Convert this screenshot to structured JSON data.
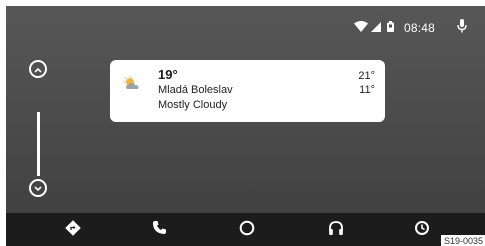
{
  "status_bar": {
    "time": "08:48",
    "icons": [
      "wifi-icon",
      "cellular-signal-icon",
      "battery-icon",
      "microphone-icon"
    ]
  },
  "scroll": {
    "up_icon": "chevron-up-icon",
    "down_icon": "chevron-down-icon"
  },
  "weather_card": {
    "icon": "partly-cloudy-icon",
    "current_temp": "19°",
    "location": "Mladá Boleslav",
    "condition": "Mostly Cloudy",
    "high": "21°",
    "low": "11°"
  },
  "nav": {
    "items": [
      {
        "icon": "navigation-icon"
      },
      {
        "icon": "phone-icon"
      },
      {
        "icon": "home-circle-icon"
      },
      {
        "icon": "headphones-icon"
      },
      {
        "icon": "recent-apps-icon"
      }
    ]
  },
  "figure_code": "S19-0035"
}
